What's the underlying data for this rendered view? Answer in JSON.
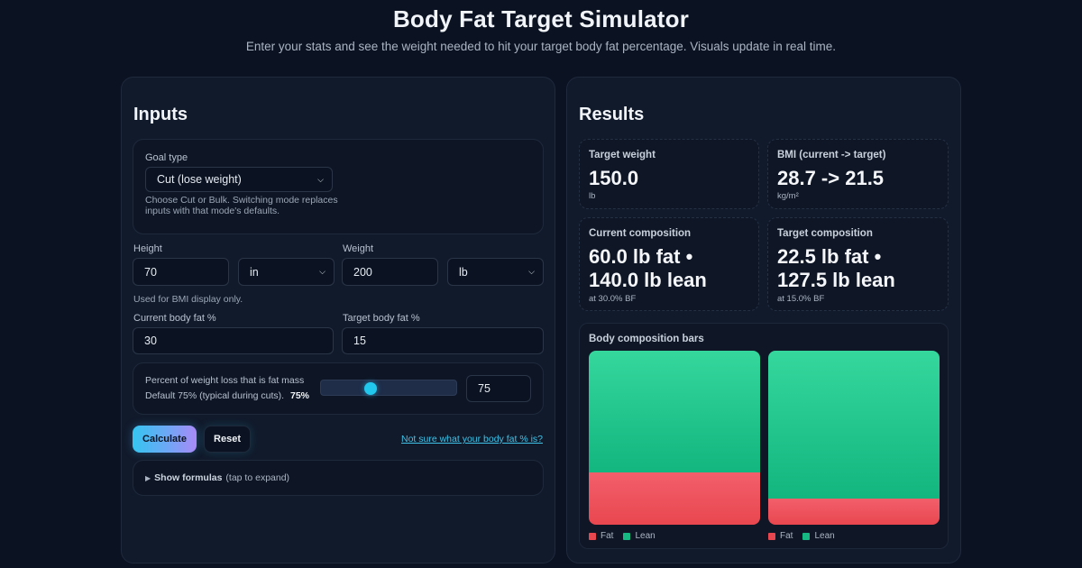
{
  "header": {
    "title": "Body Fat Target Simulator",
    "subtitle": "Enter your stats and see the weight needed to hit your target body fat percentage. Visuals update in real time."
  },
  "inputs": {
    "title": "Inputs",
    "goal": {
      "label": "Goal type",
      "value": "Cut (lose weight)",
      "hint": "Choose Cut or Bulk. Switching mode replaces inputs with that mode's defaults."
    },
    "height": {
      "label": "Height",
      "value": "70",
      "unit": "in",
      "hint": "Used for BMI display only."
    },
    "weight": {
      "label": "Weight",
      "value": "200",
      "unit": "lb"
    },
    "current_bf": {
      "label": "Current body fat %",
      "value": "30"
    },
    "target_bf": {
      "label": "Target body fat %",
      "value": "15"
    },
    "fat_share": {
      "label": "Percent of weight loss that is fat mass",
      "hint": "Default 75% (typical during cuts).",
      "display": "75%",
      "input_value": "75",
      "slider_fraction": 0.33
    },
    "calculate_label": "Calculate",
    "reset_label": "Reset",
    "help_link": "Not sure what your body fat % is?",
    "formulas": {
      "label": "Show formulas",
      "note": "(tap to expand)"
    }
  },
  "results": {
    "title": "Results",
    "target_weight": {
      "label": "Target weight",
      "value": "150.0",
      "unit": "lb"
    },
    "bmi": {
      "label": "BMI (current -> target)",
      "value": "28.7 -> 21.5",
      "unit": "kg/m²"
    },
    "current_comp": {
      "label": "Current composition",
      "line1": "60.0 lb fat •",
      "line2": "140.0 lb lean",
      "note": "at 30.0% BF"
    },
    "target_comp": {
      "label": "Target composition",
      "line1": "22.5 lb fat •",
      "line2": "127.5 lb lean",
      "note": "at 15.0% BF"
    },
    "bars": {
      "title": "Body composition bars",
      "legend_fat": "Fat",
      "legend_lean": "Lean",
      "columns": [
        {
          "fat_pct": 30,
          "lean_pct": 70
        },
        {
          "fat_pct": 15,
          "lean_pct": 85
        }
      ]
    }
  },
  "colors": {
    "fat": "#e9474f",
    "lean": "#16b982",
    "accent": "#34c5f0",
    "background": "#0b1322"
  }
}
